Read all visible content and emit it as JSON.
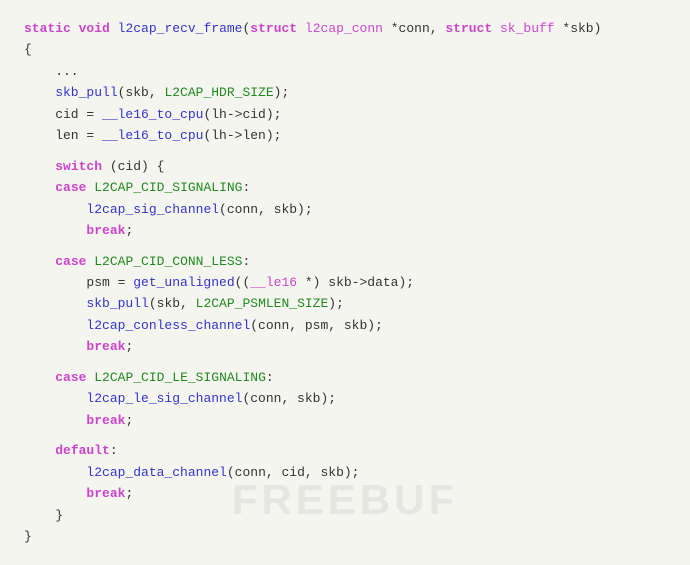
{
  "code": {
    "lines": [
      {
        "id": "l1",
        "tokens": [
          {
            "t": "kw",
            "v": "static"
          },
          {
            "t": "plain",
            "v": " "
          },
          {
            "t": "kw",
            "v": "void"
          },
          {
            "t": "plain",
            "v": " "
          },
          {
            "t": "fn",
            "v": "l2cap_recv_frame"
          },
          {
            "t": "plain",
            "v": "("
          },
          {
            "t": "kw",
            "v": "struct"
          },
          {
            "t": "plain",
            "v": " "
          },
          {
            "t": "type",
            "v": "l2cap_conn"
          },
          {
            "t": "plain",
            "v": " *conn, "
          },
          {
            "t": "kw",
            "v": "struct"
          },
          {
            "t": "plain",
            "v": " "
          },
          {
            "t": "type",
            "v": "sk_buff"
          },
          {
            "t": "plain",
            "v": " *skb)"
          }
        ]
      },
      {
        "id": "l2",
        "tokens": [
          {
            "t": "plain",
            "v": "{"
          }
        ]
      },
      {
        "id": "l3",
        "tokens": [
          {
            "t": "plain",
            "v": "    ..."
          }
        ]
      },
      {
        "id": "l4",
        "tokens": [
          {
            "t": "fn",
            "v": "    skb_pull"
          },
          {
            "t": "plain",
            "v": "(skb, "
          },
          {
            "t": "macro",
            "v": "L2CAP_HDR_SIZE"
          },
          {
            "t": "plain",
            "v": ");"
          }
        ]
      },
      {
        "id": "l5",
        "tokens": [
          {
            "t": "plain",
            "v": "    cid = "
          },
          {
            "t": "fn",
            "v": "__le16_to_cpu"
          },
          {
            "t": "plain",
            "v": "(lh->cid);"
          }
        ]
      },
      {
        "id": "l6",
        "tokens": [
          {
            "t": "plain",
            "v": "    len = "
          },
          {
            "t": "fn",
            "v": "__le16_to_cpu"
          },
          {
            "t": "plain",
            "v": "(lh->len);"
          }
        ]
      },
      {
        "id": "l7",
        "tokens": [
          {
            "t": "plain",
            "v": ""
          }
        ]
      },
      {
        "id": "l8",
        "tokens": [
          {
            "t": "plain",
            "v": "    "
          },
          {
            "t": "kw",
            "v": "switch"
          },
          {
            "t": "plain",
            "v": " (cid) {"
          }
        ]
      },
      {
        "id": "l9",
        "tokens": [
          {
            "t": "plain",
            "v": "    "
          },
          {
            "t": "kw",
            "v": "case"
          },
          {
            "t": "plain",
            "v": " "
          },
          {
            "t": "macro",
            "v": "L2CAP_CID_SIGNALING"
          },
          {
            "t": "plain",
            "v": ":"
          }
        ]
      },
      {
        "id": "l10",
        "tokens": [
          {
            "t": "plain",
            "v": "        "
          },
          {
            "t": "fn",
            "v": "l2cap_sig_channel"
          },
          {
            "t": "plain",
            "v": "(conn, skb);"
          }
        ]
      },
      {
        "id": "l11",
        "tokens": [
          {
            "t": "plain",
            "v": "        "
          },
          {
            "t": "kw",
            "v": "break"
          },
          {
            "t": "plain",
            "v": ";"
          }
        ]
      },
      {
        "id": "l12",
        "tokens": [
          {
            "t": "plain",
            "v": ""
          }
        ]
      },
      {
        "id": "l13",
        "tokens": [
          {
            "t": "plain",
            "v": "    "
          },
          {
            "t": "kw",
            "v": "case"
          },
          {
            "t": "plain",
            "v": " "
          },
          {
            "t": "macro",
            "v": "L2CAP_CID_CONN_LESS"
          },
          {
            "t": "plain",
            "v": ":"
          }
        ]
      },
      {
        "id": "l14",
        "tokens": [
          {
            "t": "plain",
            "v": "        psm = "
          },
          {
            "t": "fn",
            "v": "get_unaligned"
          },
          {
            "t": "plain",
            "v": "(("
          },
          {
            "t": "type",
            "v": "__le16"
          },
          {
            "t": "plain",
            "v": " *) skb->data);"
          }
        ]
      },
      {
        "id": "l15",
        "tokens": [
          {
            "t": "plain",
            "v": "        "
          },
          {
            "t": "fn",
            "v": "skb_pull"
          },
          {
            "t": "plain",
            "v": "(skb, "
          },
          {
            "t": "macro",
            "v": "L2CAP_PSMLEN_SIZE"
          },
          {
            "t": "plain",
            "v": ");"
          }
        ]
      },
      {
        "id": "l16",
        "tokens": [
          {
            "t": "plain",
            "v": "        "
          },
          {
            "t": "fn",
            "v": "l2cap_conless_channel"
          },
          {
            "t": "plain",
            "v": "(conn, psm, skb);"
          }
        ]
      },
      {
        "id": "l17",
        "tokens": [
          {
            "t": "plain",
            "v": "        "
          },
          {
            "t": "kw",
            "v": "break"
          },
          {
            "t": "plain",
            "v": ";"
          }
        ]
      },
      {
        "id": "l18",
        "tokens": [
          {
            "t": "plain",
            "v": ""
          }
        ]
      },
      {
        "id": "l19",
        "tokens": [
          {
            "t": "plain",
            "v": "    "
          },
          {
            "t": "kw",
            "v": "case"
          },
          {
            "t": "plain",
            "v": " "
          },
          {
            "t": "macro",
            "v": "L2CAP_CID_LE_SIGNALING"
          },
          {
            "t": "plain",
            "v": ":"
          }
        ]
      },
      {
        "id": "l20",
        "tokens": [
          {
            "t": "plain",
            "v": "        "
          },
          {
            "t": "fn",
            "v": "l2cap_le_sig_channel"
          },
          {
            "t": "plain",
            "v": "(conn, skb);"
          }
        ]
      },
      {
        "id": "l21",
        "tokens": [
          {
            "t": "plain",
            "v": "        "
          },
          {
            "t": "kw",
            "v": "break"
          },
          {
            "t": "plain",
            "v": ";"
          }
        ]
      },
      {
        "id": "l22",
        "tokens": [
          {
            "t": "plain",
            "v": ""
          }
        ]
      },
      {
        "id": "l23",
        "tokens": [
          {
            "t": "plain",
            "v": "    "
          },
          {
            "t": "kw",
            "v": "default"
          },
          {
            "t": "plain",
            "v": ":"
          }
        ]
      },
      {
        "id": "l24",
        "tokens": [
          {
            "t": "plain",
            "v": "        "
          },
          {
            "t": "fn",
            "v": "l2cap_data_channel"
          },
          {
            "t": "plain",
            "v": "(conn, cid, skb);"
          }
        ]
      },
      {
        "id": "l25",
        "tokens": [
          {
            "t": "plain",
            "v": "        "
          },
          {
            "t": "kw",
            "v": "break"
          },
          {
            "t": "plain",
            "v": ";"
          }
        ]
      },
      {
        "id": "l26",
        "tokens": [
          {
            "t": "plain",
            "v": "    }"
          }
        ]
      },
      {
        "id": "l27",
        "tokens": [
          {
            "t": "plain",
            "v": "}"
          }
        ]
      }
    ]
  },
  "watermark": {
    "text": "FREEBUF"
  }
}
